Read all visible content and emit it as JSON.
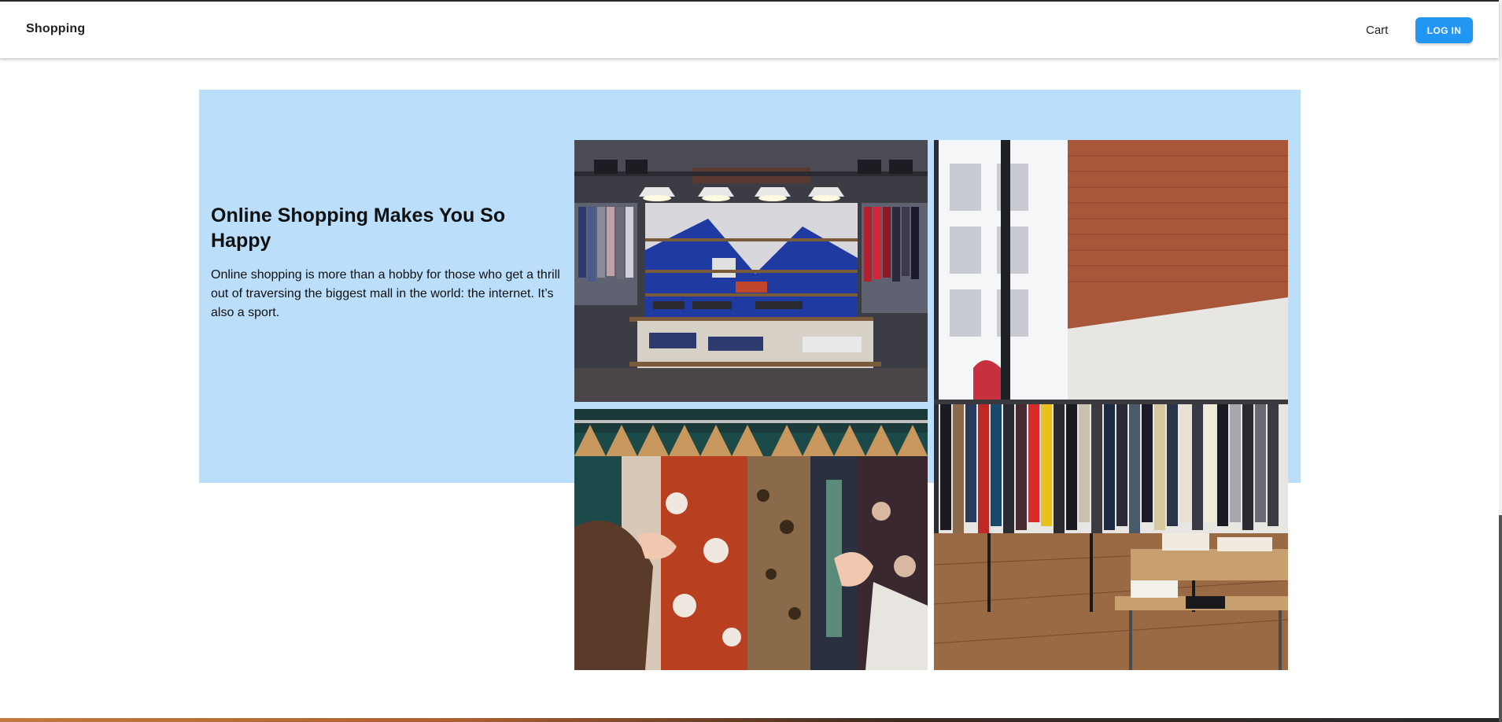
{
  "appbar": {
    "brand": "Shopping",
    "cart_label": "Cart",
    "login_label": "LOG IN"
  },
  "hero": {
    "title": "Online Shopping Makes You So Happy",
    "body": "Online shopping is more than a hobby for those who get a thrill out of traversing the biggest mall in the world: the internet. It’s also a sport.",
    "background_color": "#bbdefb"
  },
  "images": [
    {
      "name": "store-shelves-photo"
    },
    {
      "name": "clothes-hangers-photo"
    },
    {
      "name": "boutique-interior-photo"
    }
  ],
  "colors": {
    "accent": "#2196f3"
  }
}
